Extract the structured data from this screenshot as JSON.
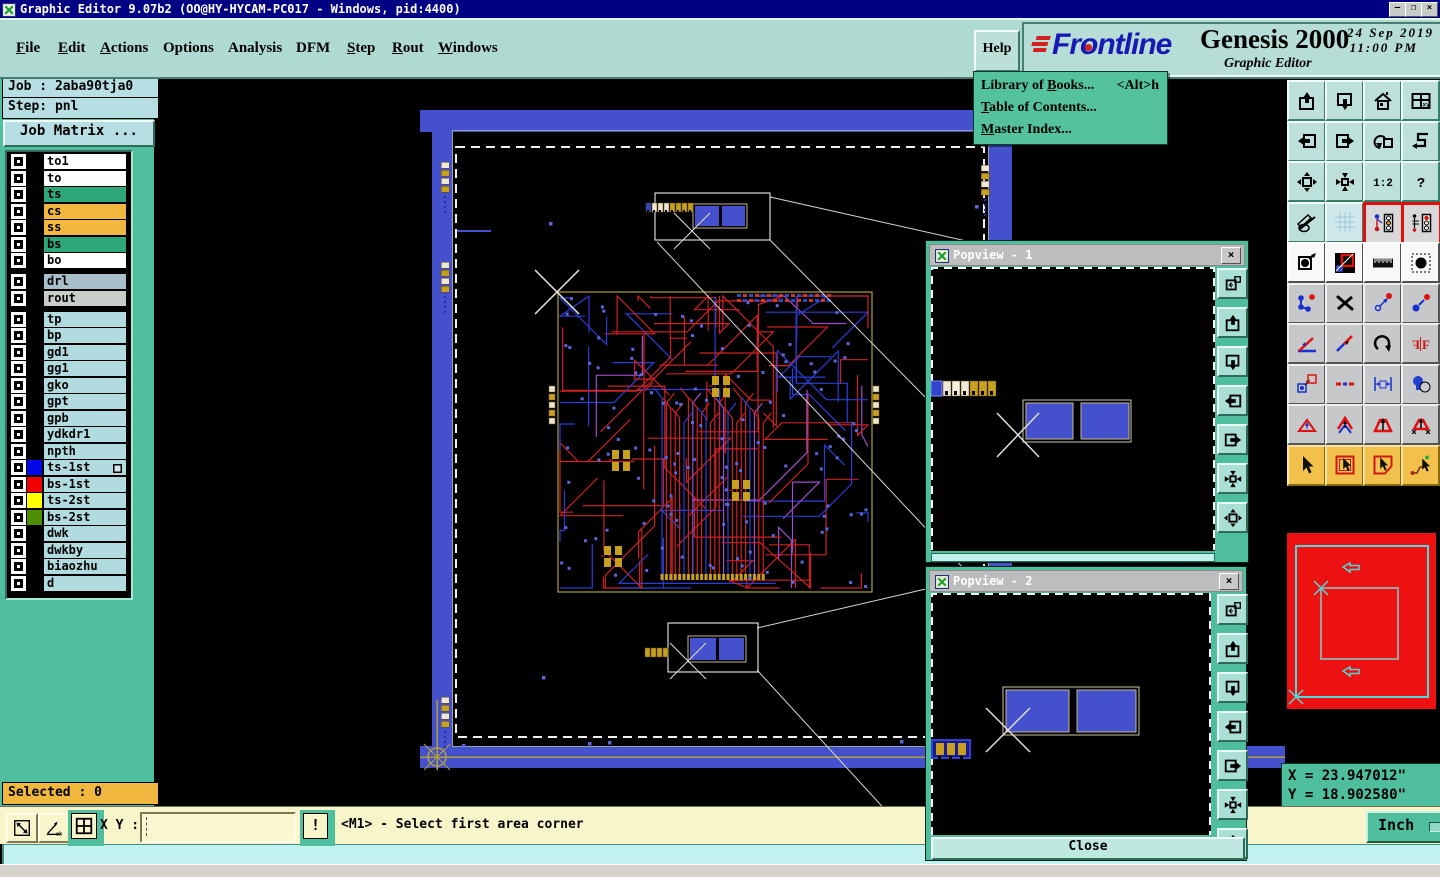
{
  "window": {
    "title": "Graphic Editor 9.07b2 (OO@HY-HYCAM-PC017 - Windows, pid:4400)",
    "minimize_glyph": "–",
    "maximize_glyph": "❐",
    "close_glyph": "×"
  },
  "menubar": {
    "items": [
      {
        "label": "File",
        "underline": 0
      },
      {
        "label": "Edit",
        "underline": 0
      },
      {
        "label": "Actions",
        "underline": 0
      },
      {
        "label": "Options",
        "underline": -1
      },
      {
        "label": "Analysis",
        "underline": -1
      },
      {
        "label": "DFM",
        "underline": -1
      },
      {
        "label": "Step",
        "underline": 0
      },
      {
        "label": "Rout",
        "underline": 0
      },
      {
        "label": "Windows",
        "underline": 0
      }
    ],
    "help_label": "Help"
  },
  "help_menu": {
    "items": [
      {
        "label": "Library of Books...",
        "underline": 11,
        "shortcut": "<Alt>h"
      },
      {
        "label": "Table of Contents...",
        "underline": 0,
        "shortcut": ""
      },
      {
        "label": "Master Index...",
        "underline": 0,
        "shortcut": ""
      }
    ]
  },
  "brand": {
    "logo_text": "Frontline",
    "product": "Genesis 2000",
    "date": "24 Sep 2019",
    "time": "11:00 PM",
    "subtitle": "Graphic Editor"
  },
  "sidebar": {
    "job_label": "Job : 2aba90tja0",
    "step_label": "Step: pnl",
    "job_matrix_label": "Job Matrix ...",
    "selected_label": "Selected : 0",
    "layer_groups": [
      {
        "layers": [
          {
            "name": "to1",
            "bg": "#FFFFFF"
          },
          {
            "name": "to",
            "bg": "#FFFFFF"
          },
          {
            "name": "ts",
            "bg": "#2EA878"
          },
          {
            "name": "cs",
            "bg": "#F2B73F"
          },
          {
            "name": "ss",
            "bg": "#F2B73F"
          },
          {
            "name": "bs",
            "bg": "#2EA878"
          },
          {
            "name": "bo",
            "bg": "#FFFFFF"
          }
        ]
      },
      {
        "layers": [
          {
            "name": "drl",
            "bg": "#A9BECB"
          },
          {
            "name": "rout",
            "bg": "#C9CDC9"
          }
        ]
      },
      {
        "layers": [
          {
            "name": "tp",
            "bg": "#B2DBDF"
          },
          {
            "name": "bp",
            "bg": "#B2DBDF"
          },
          {
            "name": "gd1",
            "bg": "#B2DBDF"
          },
          {
            "name": "gg1",
            "bg": "#B2DBDF"
          },
          {
            "name": "gko",
            "bg": "#B2DBDF"
          },
          {
            "name": "gpt",
            "bg": "#B2DBDF"
          },
          {
            "name": "gpb",
            "bg": "#B2DBDF"
          },
          {
            "name": "ydkdr1",
            "bg": "#B2DBDF"
          },
          {
            "name": "npth",
            "bg": "#B2DBDF"
          },
          {
            "name": "ts-1st",
            "bg": "#B2DBDF",
            "swatch": "#0008E8",
            "marker": true
          },
          {
            "name": "bs-1st",
            "bg": "#B2DBDF",
            "swatch": "#F20000"
          },
          {
            "name": "ts-2st",
            "bg": "#B2DBDF",
            "swatch": "#FFFF00"
          },
          {
            "name": "bs-2st",
            "bg": "#B2DBDF",
            "swatch": "#4E8F00"
          },
          {
            "name": "dwk",
            "bg": "#B2DBDF"
          },
          {
            "name": "dwkby",
            "bg": "#B2DBDF"
          },
          {
            "name": "biaozhu",
            "bg": "#B2DBDF"
          },
          {
            "name": "d",
            "bg": "#B2DBDF"
          }
        ]
      }
    ]
  },
  "statusbar": {
    "xy_label": "X Y :",
    "xy_value": "",
    "alert_label": "!",
    "message": "<M1> - Select first area corner",
    "unit_label": "Inch"
  },
  "coords": {
    "x": "X = 23.947012\"",
    "y": "Y = 18.902580\""
  },
  "popviews": [
    {
      "title": "Popview - 1"
    },
    {
      "title": "Popview - 2",
      "close_label": "Close"
    }
  ],
  "right_toolbar": {
    "icons": [
      [
        "paste-up",
        "paste-down",
        "home",
        "window-xy"
      ],
      [
        "exit-left",
        "exit-right",
        "undo-step",
        "route-s"
      ],
      [
        "zoom-extents",
        "zoom-center",
        "scale-1-2",
        "help-question"
      ],
      [
        "edit-tools",
        "snap-grid",
        "net-lights-a",
        "net-lights-b"
      ],
      [
        "select-copy",
        "negative-view",
        "measure-ruler",
        "pad-select"
      ],
      [
        "net-chain",
        "delete-x",
        "move-point-small",
        "move-point"
      ],
      [
        "angle-measure",
        "line-slope",
        "rotate-cw",
        "mirror-text"
      ],
      [
        "copy-pad",
        "dash-line",
        "measure-width",
        "shape-circles"
      ],
      [
        "triangle-a",
        "triangle-b",
        "triangle-c",
        "triangle-d"
      ],
      [
        "cursor-select",
        "cursor-frame",
        "cursor-polygon",
        "cursor-net"
      ]
    ]
  },
  "popview_toolbar": {
    "icons": [
      "copy-window",
      "pan-up",
      "pan-down",
      "pan-left",
      "pan-right",
      "zoom-fit",
      "zoom-pan"
    ]
  },
  "bottom_toolbar": {
    "icons": [
      "resize-area",
      "angle-snap",
      "grid-toggle"
    ]
  },
  "colors": {
    "accent_teal": "#4FBE9D",
    "panel_blue": "#4550CC",
    "selected_orange": "#F2B73F",
    "trace_red": "#CC2222",
    "trace_blue": "#2A3ED6",
    "pad_gold": "#C8A020",
    "board_olive": "#AFA03C"
  }
}
